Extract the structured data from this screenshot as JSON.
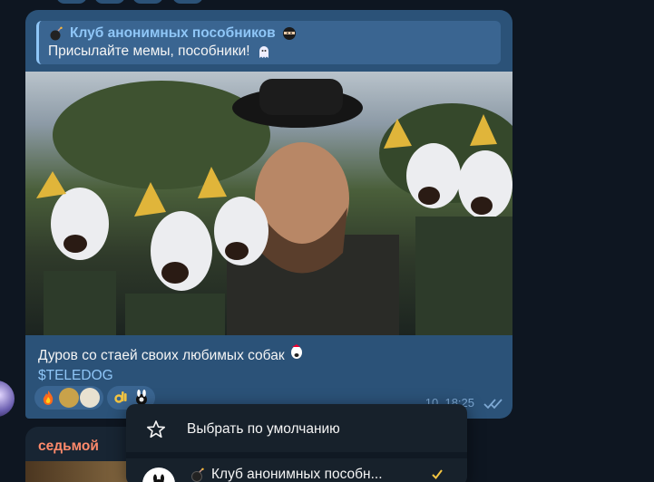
{
  "message": {
    "forward": {
      "channel_name": "Клуб анонимных пособников",
      "text": "Присылайте мемы, пособники!",
      "icon_before": "bomb-icon",
      "icon_after": "ninja-icon",
      "text_icon": "ghost-icon"
    },
    "caption": "Дуров со стаей своих любимых собак",
    "caption_icon": "dog-face-icon",
    "tag": "$TELEDOG",
    "reactions": [
      "fire-icon",
      "avatar-icon",
      "avatar-icon",
      "ok-hand-icon",
      "bunny-icon"
    ],
    "time": "10, 18:25",
    "status": "read-double-check-icon"
  },
  "next_message": {
    "sender": "седьмой"
  },
  "context_menu": {
    "item_default_label": "Выбрать по умолчанию",
    "item_default_icon": "star-icon",
    "account_name": "Клуб анонимных пособн..."
  },
  "colors": {
    "bubble": "#2b5278",
    "accent": "#8fc6f7",
    "background": "#0e1621",
    "menu": "#17212b"
  }
}
